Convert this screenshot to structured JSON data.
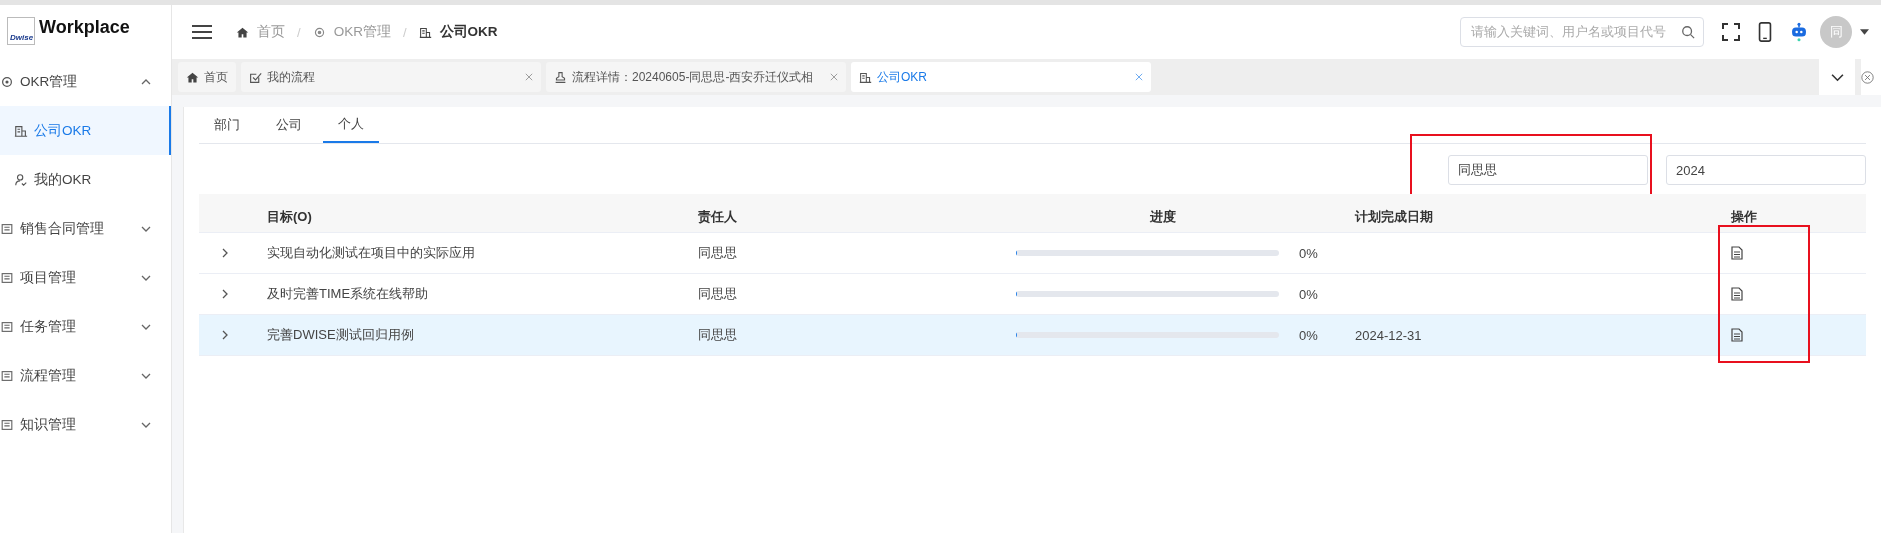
{
  "logo": {
    "mark": "Dwise",
    "title": "Workplace"
  },
  "sidebar": {
    "items": [
      {
        "label": "OKR管理",
        "expanded": true,
        "children": [
          {
            "label": "公司OKR",
            "selected": true
          },
          {
            "label": "我的OKR",
            "selected": false
          }
        ]
      },
      {
        "label": "销售合同管理",
        "expanded": false
      },
      {
        "label": "项目管理",
        "expanded": false
      },
      {
        "label": "任务管理",
        "expanded": false
      },
      {
        "label": "流程管理",
        "expanded": false
      },
      {
        "label": "知识管理",
        "expanded": false
      }
    ]
  },
  "breadcrumb": [
    {
      "label": "首页",
      "current": false
    },
    {
      "separator": "/",
      "label": "OKR管理",
      "current": false
    },
    {
      "separator": "/",
      "label": "公司OKR",
      "current": true
    }
  ],
  "search": {
    "placeholder": "请输入关键词、用户名或项目代号"
  },
  "avatar": "同",
  "page_tabs": [
    {
      "label": "首页",
      "closable": false,
      "selected": false
    },
    {
      "label": "我的流程",
      "closable": true,
      "selected": false
    },
    {
      "label": "流程详情：20240605-同思思-西安乔迁仪式相",
      "closable": true,
      "selected": false
    },
    {
      "label": "公司OKR",
      "closable": true,
      "selected": true
    }
  ],
  "tabs": [
    {
      "label": "部门",
      "selected": false
    },
    {
      "label": "公司",
      "selected": false
    },
    {
      "label": "个人",
      "selected": true
    }
  ],
  "filters": {
    "person": "同思思",
    "year": "2024"
  },
  "table": {
    "columns": [
      "目标(O)",
      "责任人",
      "进度",
      "计划完成日期",
      "操作"
    ],
    "rows": [
      {
        "objective": "实现自动化测试在项目中的实际应用",
        "owner": "同思思",
        "level": 0,
        "progress": "0%",
        "selected": false
      },
      {
        "objective": "及时完善TIME系统在线帮助",
        "owner": "同思思",
        "level": 0,
        "progress": "0%",
        "selected": false
      },
      {
        "objective": "完善DWISE测试回归用例",
        "owner": "同思思",
        "level": 0,
        "progress": "0%",
        "due": "2024-12-31",
        "selected": true
      }
    ]
  }
}
